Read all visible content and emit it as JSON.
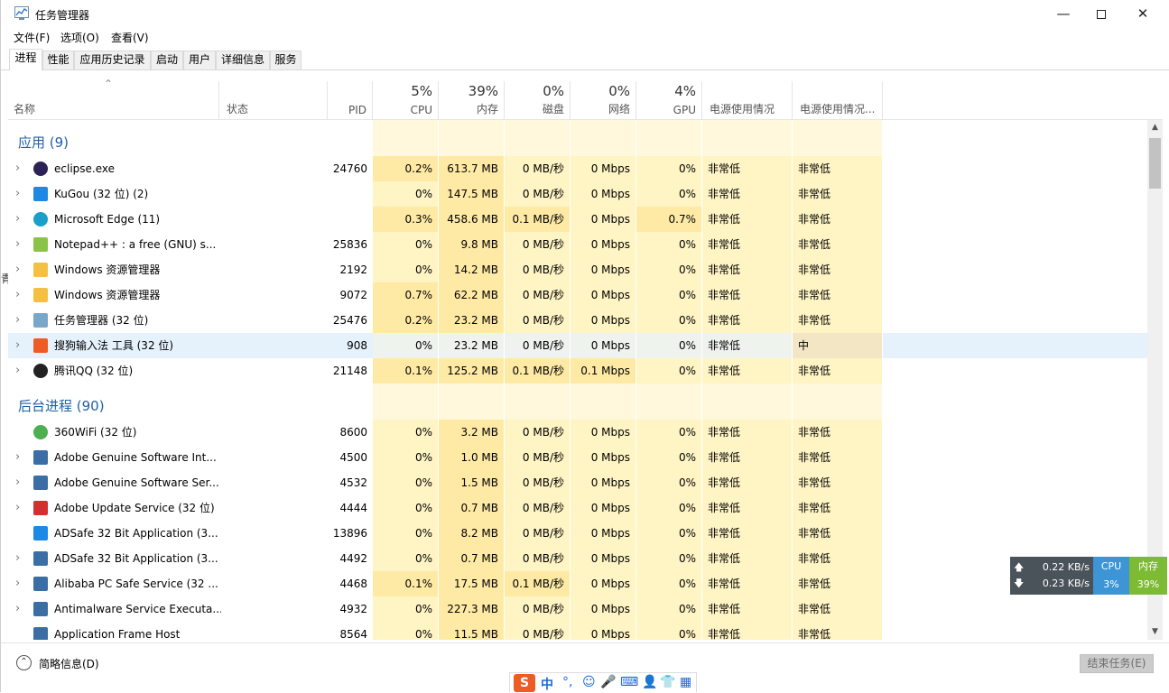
{
  "window": {
    "title": "任务管理器"
  },
  "menu": [
    "文件(F)",
    "选项(O)",
    "查看(V)"
  ],
  "tabs": [
    "进程",
    "性能",
    "应用历史记录",
    "启动",
    "用户",
    "详细信息",
    "服务"
  ],
  "header": {
    "name": "名称",
    "status": "状态",
    "pid": "PID",
    "cpu_pct": "5%",
    "cpu": "CPU",
    "mem_pct": "39%",
    "mem": "内存",
    "disk_pct": "0%",
    "disk": "磁盘",
    "net_pct": "0%",
    "net": "网络",
    "gpu_pct": "4%",
    "gpu": "GPU",
    "power": "电源使用情况",
    "power_trend": "电源使用情况..."
  },
  "groups": [
    {
      "title": "应用 (9)",
      "rows": [
        {
          "name": "eclipse.exe",
          "pid": "24760",
          "cpu": "0.2%",
          "mem": "613.7 MB",
          "disk": "0 MB/秒",
          "net": "0 Mbps",
          "gpu": "0%",
          "power": "非常低",
          "trend": "非常低",
          "icon": "eclipse-icon",
          "color": "#2c2255",
          "expand": true
        },
        {
          "name": "KuGou (32 位) (2)",
          "pid": "",
          "cpu": "0%",
          "mem": "147.5 MB",
          "disk": "0 MB/秒",
          "net": "0 Mbps",
          "gpu": "0%",
          "power": "非常低",
          "trend": "非常低",
          "icon": "kugou-icon",
          "color": "#1e88e5",
          "expand": true
        },
        {
          "name": "Microsoft Edge (11)",
          "pid": "",
          "cpu": "0.3%",
          "mem": "458.6 MB",
          "disk": "0.1 MB/秒",
          "net": "0 Mbps",
          "gpu": "0.7%",
          "power": "非常低",
          "trend": "非常低",
          "icon": "edge-icon",
          "color": "#1aa0c8",
          "expand": true
        },
        {
          "name": "Notepad++ : a free (GNU) s...",
          "pid": "25836",
          "cpu": "0%",
          "mem": "9.8 MB",
          "disk": "0 MB/秒",
          "net": "0 Mbps",
          "gpu": "0%",
          "power": "非常低",
          "trend": "非常低",
          "icon": "notepadpp-icon",
          "color": "#8bc34a",
          "expand": true
        },
        {
          "name": "Windows 资源管理器",
          "pid": "2192",
          "cpu": "0%",
          "mem": "14.2 MB",
          "disk": "0 MB/秒",
          "net": "0 Mbps",
          "gpu": "0%",
          "power": "非常低",
          "trend": "非常低",
          "icon": "folder-icon",
          "color": "#f3c043",
          "expand": true
        },
        {
          "name": "Windows 资源管理器",
          "pid": "9072",
          "cpu": "0.7%",
          "mem": "62.2 MB",
          "disk": "0 MB/秒",
          "net": "0 Mbps",
          "gpu": "0%",
          "power": "非常低",
          "trend": "非常低",
          "icon": "folder-icon",
          "color": "#f3c043",
          "expand": true
        },
        {
          "name": "任务管理器 (32 位)",
          "pid": "25476",
          "cpu": "0.2%",
          "mem": "23.2 MB",
          "disk": "0 MB/秒",
          "net": "0 Mbps",
          "gpu": "0%",
          "power": "非常低",
          "trend": "非常低",
          "icon": "task-manager-icon",
          "color": "#7aa7c7",
          "expand": true
        },
        {
          "name": "搜狗输入法 工具 (32 位)",
          "pid": "908",
          "cpu": "0%",
          "mem": "23.2 MB",
          "disk": "0 MB/秒",
          "net": "0 Mbps",
          "gpu": "0%",
          "power": "非常低",
          "trend": "中",
          "icon": "sogou-icon",
          "color": "#ef5b25",
          "expand": true,
          "selected": true
        },
        {
          "name": "腾讯QQ (32 位)",
          "pid": "21148",
          "cpu": "0.1%",
          "mem": "125.2 MB",
          "disk": "0.1 MB/秒",
          "net": "0.1 Mbps",
          "gpu": "0%",
          "power": "非常低",
          "trend": "非常低",
          "icon": "qq-icon",
          "color": "#222222",
          "expand": true
        }
      ]
    },
    {
      "title": "后台进程 (90)",
      "rows": [
        {
          "name": "360WiFi (32 位)",
          "pid": "8600",
          "cpu": "0%",
          "mem": "3.2 MB",
          "disk": "0 MB/秒",
          "net": "0 Mbps",
          "gpu": "0%",
          "power": "非常低",
          "trend": "非常低",
          "icon": "wifi360-icon",
          "color": "#4caf50",
          "expand": false
        },
        {
          "name": "Adobe Genuine Software Int...",
          "pid": "4500",
          "cpu": "0%",
          "mem": "1.0 MB",
          "disk": "0 MB/秒",
          "net": "0 Mbps",
          "gpu": "0%",
          "power": "非常低",
          "trend": "非常低",
          "icon": "service-window-icon",
          "color": "#3a6ea5",
          "expand": true
        },
        {
          "name": "Adobe Genuine Software Ser...",
          "pid": "4532",
          "cpu": "0%",
          "mem": "1.5 MB",
          "disk": "0 MB/秒",
          "net": "0 Mbps",
          "gpu": "0%",
          "power": "非常低",
          "trend": "非常低",
          "icon": "service-window-icon",
          "color": "#3a6ea5",
          "expand": true
        },
        {
          "name": "Adobe Update Service (32 位)",
          "pid": "4444",
          "cpu": "0%",
          "mem": "0.7 MB",
          "disk": "0 MB/秒",
          "net": "0 Mbps",
          "gpu": "0%",
          "power": "非常低",
          "trend": "非常低",
          "icon": "adobe-icon",
          "color": "#d32f2f",
          "expand": true
        },
        {
          "name": "ADSafe 32 Bit Application (3...",
          "pid": "13896",
          "cpu": "0%",
          "mem": "8.2 MB",
          "disk": "0 MB/秒",
          "net": "0 Mbps",
          "gpu": "0%",
          "power": "非常低",
          "trend": "非常低",
          "icon": "adsafe-icon",
          "color": "#1e88e5",
          "expand": false
        },
        {
          "name": "ADSafe 32 Bit Application (3...",
          "pid": "4492",
          "cpu": "0%",
          "mem": "0.7 MB",
          "disk": "0 MB/秒",
          "net": "0 Mbps",
          "gpu": "0%",
          "power": "非常低",
          "trend": "非常低",
          "icon": "service-window-icon",
          "color": "#3a6ea5",
          "expand": true
        },
        {
          "name": "Alibaba PC Safe Service (32 ...",
          "pid": "4468",
          "cpu": "0.1%",
          "mem": "17.5 MB",
          "disk": "0.1 MB/秒",
          "net": "0 Mbps",
          "gpu": "0%",
          "power": "非常低",
          "trend": "非常低",
          "icon": "service-window-icon",
          "color": "#3a6ea5",
          "expand": true
        },
        {
          "name": "Antimalware Service Executa...",
          "pid": "4932",
          "cpu": "0%",
          "mem": "227.3 MB",
          "disk": "0 MB/秒",
          "net": "0 Mbps",
          "gpu": "0%",
          "power": "非常低",
          "trend": "非常低",
          "icon": "service-window-icon",
          "color": "#3a6ea5",
          "expand": true
        },
        {
          "name": "Application Frame Host",
          "pid": "8564",
          "cpu": "0%",
          "mem": "11.5 MB",
          "disk": "0 MB/秒",
          "net": "0 Mbps",
          "gpu": "0%",
          "power": "非常低",
          "trend": "非常低",
          "icon": "service-window-icon",
          "color": "#3a6ea5",
          "expand": false
        }
      ]
    }
  ],
  "footer": {
    "fewer_details": "简略信息(D)",
    "end_task": "结束任务(E)"
  },
  "net_widget": {
    "up": "0.22 KB/s",
    "down": "0.23 KB/s",
    "cpu_label": "CPU",
    "cpu_value": "3%",
    "mem_label": "内存",
    "mem_value": "39%"
  },
  "ime": {
    "logo": "S",
    "mode": "中",
    "items": [
      "°,",
      "☺",
      "🎤",
      "⌨",
      "👤",
      "👕",
      "▦"
    ]
  },
  "left_fragment": "青",
  "colors": {
    "heat_light": "#fff4c4",
    "heat_mid": "#ffeaa5",
    "heat_group": "#fff8dc",
    "selected": "#e5f1fb",
    "group_title": "#1f5fa8"
  }
}
